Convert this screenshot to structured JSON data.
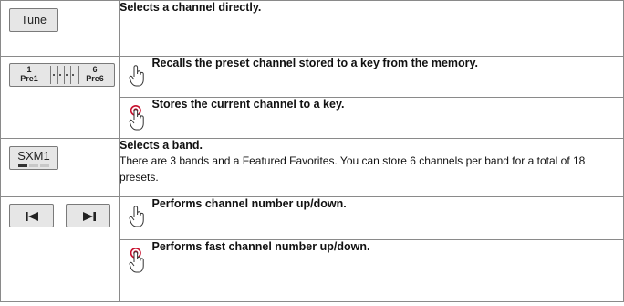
{
  "rows": {
    "tune": {
      "button_label": "Tune",
      "button_icon": "tune-key",
      "description": "Selects a channel directly."
    },
    "preset": {
      "left_number": "1",
      "left_label": "Pre1",
      "right_number": "6",
      "right_label": "Pre6",
      "touch_action": "Recalls the preset channel stored to a key from the memory.",
      "touch_icon": "tap-finger-icon",
      "hold_action": "Stores the current channel to a key.",
      "hold_icon": "touch-and-hold-finger-icon"
    },
    "band": {
      "button_label": "SXM1",
      "active_band_index": 0,
      "band_count_bars": 3,
      "description": "Selects a band.",
      "detail": "There are 3 bands and a Featured Favorites. You can store 6 channels per band for a total of 18 presets."
    },
    "channel": {
      "prev_icon": "skip-previous-icon",
      "next_icon": "skip-next-icon",
      "touch_action": "Performs channel number up/down.",
      "touch_icon": "tap-finger-icon",
      "hold_action": "Performs fast channel number up/down.",
      "hold_icon": "touch-and-hold-finger-icon"
    }
  },
  "colors": {
    "key_fill": "#e6e6e6",
    "border": "#8a8a8a",
    "hold_ring": "#c8102e"
  }
}
